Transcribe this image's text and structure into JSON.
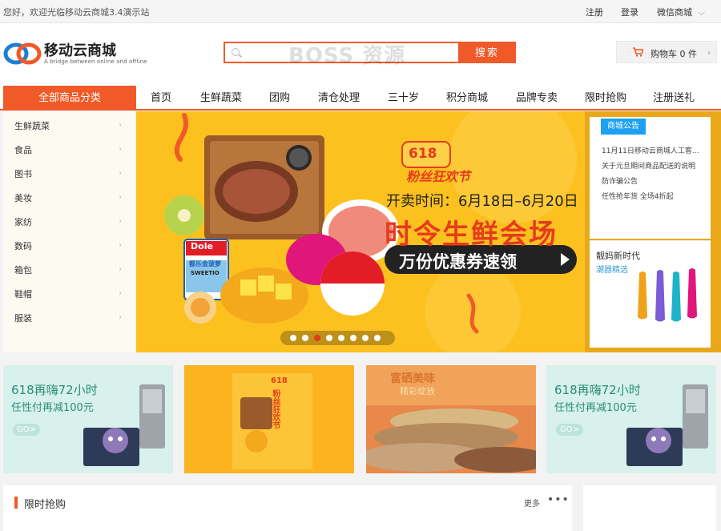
{
  "topbar": {
    "welcome": "您好，欢迎光临移动云商城3.4演示站",
    "register": "注册",
    "login": "登录",
    "wechat": "微信商城",
    "wechat_arrow": "⌵"
  },
  "brand": {
    "name": "移动云商城",
    "tagline": "A bridge between online and offline",
    "color": "#f05a28"
  },
  "search": {
    "value": "",
    "placeholder": "",
    "button": "搜索",
    "watermark": "BOSS 资源"
  },
  "cart": {
    "label": "购物车 0 件",
    "arrow": "›"
  },
  "nav": {
    "all_categories": "全部商品分类",
    "items": [
      "首页",
      "生鲜蔬菜",
      "团购",
      "清仓处理",
      "三十岁",
      "积分商城",
      "品牌专卖",
      "限时抢购",
      "注册送礼"
    ]
  },
  "sidebar": {
    "categories": [
      "生鲜蔬菜",
      "食品",
      "图书",
      "美妆",
      "家纺",
      "数码",
      "箱包",
      "鞋帽",
      "服装"
    ],
    "chevron": "›"
  },
  "banner": {
    "badge_618": "618",
    "festival": "粉丝狂欢节",
    "dates": "开卖时间：6月18日–6月20日",
    "headline": "时令生鲜会场",
    "coupon": "万份优惠券速领",
    "pineapple_brand": "Dole",
    "pineapple_label": "都乐金菠萝",
    "pineapple_sub": "SWEETIO",
    "dot_count": 8,
    "active_dot": 3
  },
  "notice": {
    "tag": "商城公告",
    "items": [
      "11月11日移动云商城人工客...",
      "关于元旦期间商品配送的说明",
      "防诈骗公告",
      "任性抢年货 全场4折起"
    ]
  },
  "promo": {
    "title": "靓妈新时代",
    "subtitle": "潮器精选"
  },
  "ads": [
    {
      "line1": "618再嗨72小时",
      "line2": "任性付再减100元",
      "go": "GO>"
    },
    {
      "line1": "618",
      "line2": "粉丝狂欢节"
    },
    {
      "line1": "富硒美味",
      "line2": "精彩绽放"
    },
    {
      "line1": "618再嗨72小时",
      "line2": "任性付再减100元",
      "go": "GO>"
    }
  ],
  "section": {
    "title": "限时抢购",
    "more": "更多",
    "dots": "•••"
  }
}
